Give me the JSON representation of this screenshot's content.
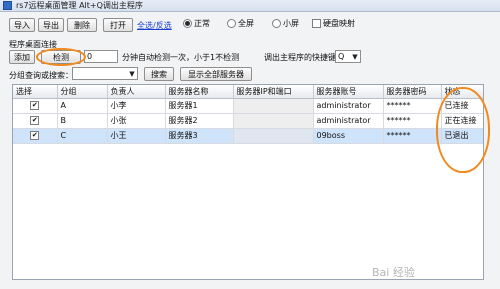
{
  "window": {
    "title": "rs7远程桌面管理 Alt+Q调出主程序"
  },
  "toolbar": {
    "import_label": "导入",
    "export_label": "导出",
    "delete_label": "删除",
    "open_label": "打开",
    "select_all_link": "全选/反选",
    "radio_normal": "正常",
    "radio_fullscreen": "全屏",
    "radio_small": "小屏",
    "disk_mapping_label": "硬盘映射",
    "selected_mode": "正常",
    "disk_mapping_checked": false
  },
  "group": {
    "label": "程序桌面连接",
    "add_label": "添加",
    "detect_label": "检测",
    "interval_value": "0",
    "interval_text": "分钟自动检测一次，小于1不检测",
    "hotkey_label": "调出主程序的快捷键：Alt",
    "hotkey_value": "Q",
    "search_label": "分组查询或搜索：",
    "search_value": "",
    "search_button": "搜索",
    "show_all_button": "显示全部服务器"
  },
  "table": {
    "columns": [
      "选择",
      "分组",
      "负责人",
      "服务器名称",
      "服务器IP和端口",
      "服务器账号",
      "服务器密码",
      "状态"
    ],
    "rows": [
      {
        "checked": true,
        "group": "A",
        "owner": "小李",
        "name": "服务器1",
        "ip": "",
        "account": "administrator",
        "password": "******",
        "status": "已连接"
      },
      {
        "checked": true,
        "group": "B",
        "owner": "小张",
        "name": "服务器2",
        "ip": "",
        "account": "administrator",
        "password": "******",
        "status": "正在连接"
      },
      {
        "checked": true,
        "group": "C",
        "owner": "小王",
        "name": "服务器3",
        "ip": "",
        "account": "09boss",
        "password": "******",
        "status": "已退出"
      }
    ]
  },
  "watermark": "Bai 经验",
  "colors": {
    "accent_annotation": "#f08a1e",
    "selected_row": "#cfe3fb",
    "link": "#1a3fd0"
  }
}
